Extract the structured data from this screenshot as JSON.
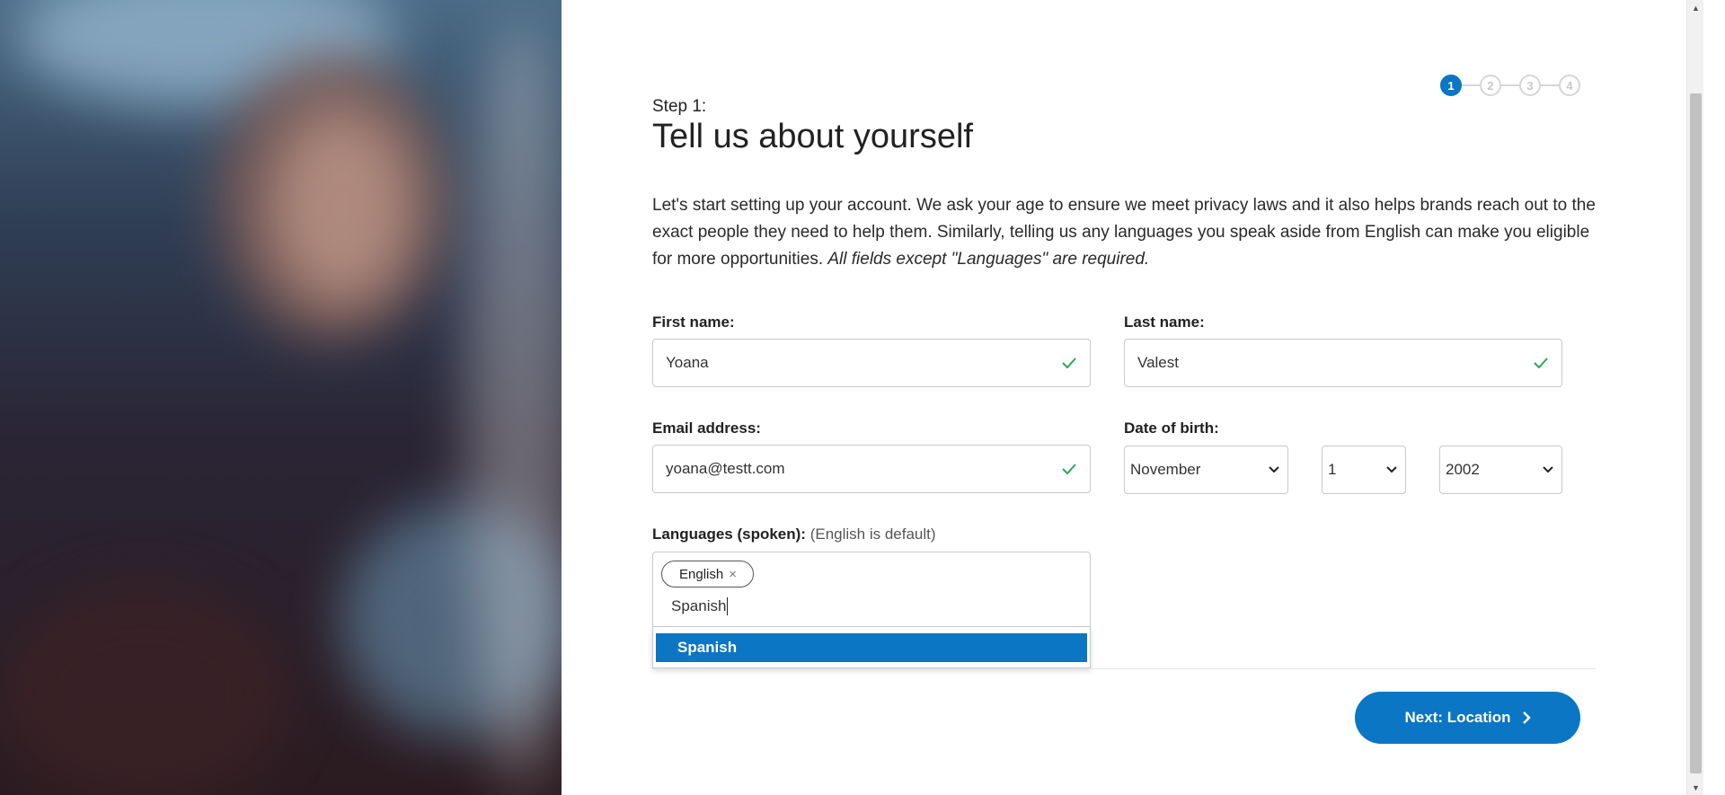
{
  "stepper": {
    "steps": [
      "1",
      "2",
      "3",
      "4"
    ],
    "active_step": 1
  },
  "header": {
    "step_label": "Step 1:",
    "title": "Tell us about yourself"
  },
  "intro": {
    "text": "Let's start setting up your account. We ask your age to ensure we meet privacy laws and it also helps brands reach out to the exact people they need to help them. Similarly, telling us any languages you speak aside from English can make you eligible for more opportunities. ",
    "note": "All fields except \"Languages\" are required."
  },
  "form": {
    "first_name": {
      "label": "First name:",
      "value": "Yoana"
    },
    "last_name": {
      "label": "Last name:",
      "value": "Valest"
    },
    "email": {
      "label": "Email address:",
      "value": "yoana@testt.com"
    },
    "dob": {
      "label": "Date of birth:",
      "month": "November",
      "day": "1",
      "year": "2002"
    },
    "languages": {
      "label": "Languages (spoken):",
      "hint": "(English is default)",
      "tags": [
        "English"
      ],
      "tag_remove": "×",
      "input_value": "Spanish",
      "suggestions": [
        "Spanish"
      ]
    }
  },
  "actions": {
    "next_label": "Next: Location"
  },
  "scrollbar": {
    "up": "▲",
    "down": "▼"
  },
  "colors": {
    "primary": "#0a76c4",
    "valid": "#2aa55a"
  },
  "icons": {
    "check": "check-icon",
    "chevron": "chevron-down-icon",
    "arrow": "chevron-right-icon"
  }
}
